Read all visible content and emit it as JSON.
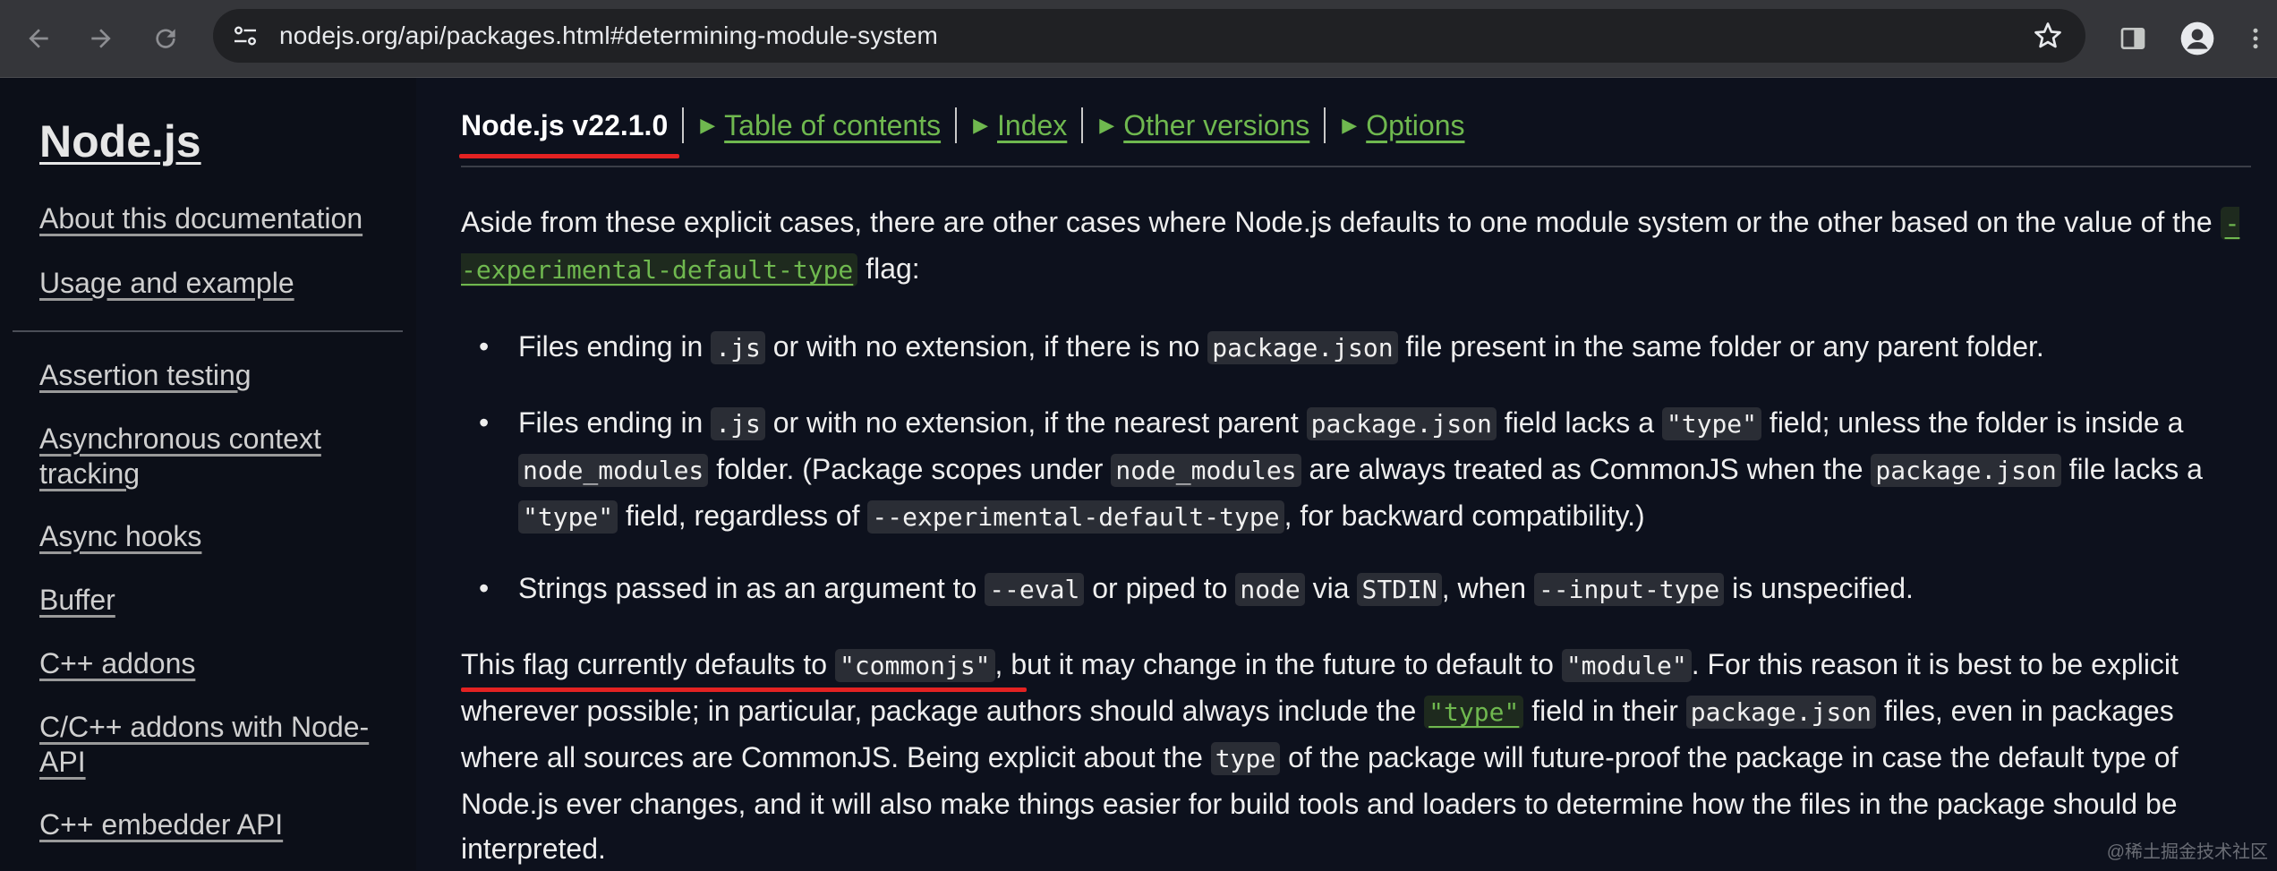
{
  "browser": {
    "url": "nodejs.org/api/packages.html#determining-module-system"
  },
  "sidebar": {
    "logo": "Node.js",
    "links_top": [
      "About this documentation",
      "Usage and example"
    ],
    "links": [
      "Assertion testing",
      "Asynchronous context tracking",
      "Async hooks",
      "Buffer",
      "C++ addons",
      "C/C++ addons with Node-API",
      "C++ embedder API"
    ]
  },
  "topnav": {
    "version": "Node.js v22.1.0",
    "links": [
      "Table of contents",
      "Index",
      "Other versions",
      "Options"
    ]
  },
  "content": {
    "intro": {
      "text_before": "Aside from these explicit cases, there are other cases where Node.js defaults to one module system or the other based on the value of the ",
      "flag_link": "--experimental-default-type",
      "text_after": " flag:"
    },
    "bullets": [
      {
        "parts": [
          {
            "t": "text",
            "v": "Files ending in "
          },
          {
            "t": "code",
            "v": ".js"
          },
          {
            "t": "text",
            "v": " or with no extension, if there is no "
          },
          {
            "t": "code",
            "v": "package.json"
          },
          {
            "t": "text",
            "v": " file present in the same folder or any parent folder."
          }
        ]
      },
      {
        "parts": [
          {
            "t": "text",
            "v": "Files ending in "
          },
          {
            "t": "code",
            "v": ".js"
          },
          {
            "t": "text",
            "v": " or with no extension, if the nearest parent "
          },
          {
            "t": "code",
            "v": "package.json"
          },
          {
            "t": "text",
            "v": " field lacks a "
          },
          {
            "t": "code",
            "v": "\"type\""
          },
          {
            "t": "text",
            "v": " field; unless the folder is inside a "
          },
          {
            "t": "code",
            "v": "node_modules"
          },
          {
            "t": "text",
            "v": " folder. (Package scopes under "
          },
          {
            "t": "code",
            "v": "node_modules"
          },
          {
            "t": "text",
            "v": " are always treated as CommonJS when the "
          },
          {
            "t": "code",
            "v": "package.json"
          },
          {
            "t": "text",
            "v": " file lacks a "
          },
          {
            "t": "code",
            "v": "\"type\""
          },
          {
            "t": "text",
            "v": " field, regardless of "
          },
          {
            "t": "code",
            "v": "--experimental-default-type"
          },
          {
            "t": "text",
            "v": ", for backward compatibility.)"
          }
        ]
      },
      {
        "parts": [
          {
            "t": "text",
            "v": "Strings passed in as an argument to "
          },
          {
            "t": "code",
            "v": "--eval"
          },
          {
            "t": "text",
            "v": " or piped to "
          },
          {
            "t": "code",
            "v": "node"
          },
          {
            "t": "text",
            "v": " via "
          },
          {
            "t": "code",
            "v": "STDIN"
          },
          {
            "t": "text",
            "v": ", when "
          },
          {
            "t": "code",
            "v": "--input-type"
          },
          {
            "t": "text",
            "v": " is unspecified."
          }
        ]
      }
    ],
    "closing": {
      "parts": [
        {
          "t": "text",
          "v": "This flag currently defaults to "
        },
        {
          "t": "code",
          "v": "\"commonjs\""
        },
        {
          "t": "text",
          "v": ", but it may change in the future to default to "
        },
        {
          "t": "code",
          "v": "\"module\""
        },
        {
          "t": "text",
          "v": ". For this reason it is best to be explicit wherever possible; in particular, package authors should always include the "
        },
        {
          "t": "link",
          "v": "\"type\""
        },
        {
          "t": "text",
          "v": " field in their "
        },
        {
          "t": "code",
          "v": "package.json"
        },
        {
          "t": "text",
          "v": " files, even in packages where all sources are CommonJS. Being explicit about the "
        },
        {
          "t": "code",
          "v": "type"
        },
        {
          "t": "text",
          "v": " of the package will future-proof the package in case the default type of Node.js ever changes, and it will also make things easier for build tools and loaders to determine how the files in the package should be interpreted."
        }
      ]
    }
  },
  "watermark": "@稀土掘金技术社区",
  "colors": {
    "link_green": "#6fb84f",
    "annotation_red": "#e32222",
    "background": "#0d111d"
  }
}
